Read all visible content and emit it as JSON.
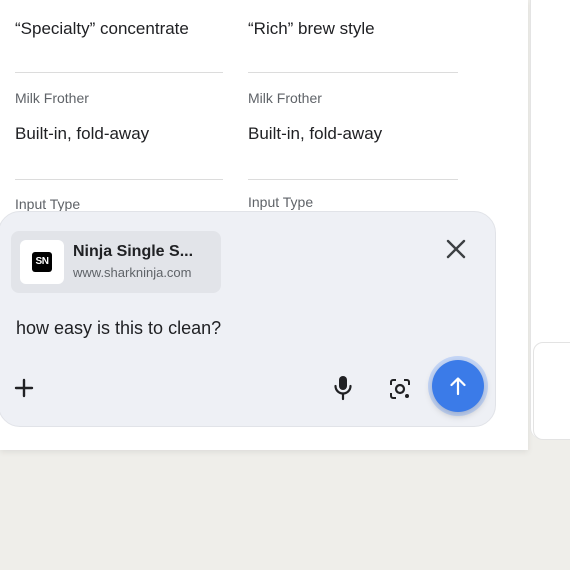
{
  "specs": [
    {
      "label": "",
      "value": "“Specialty” concentrate"
    },
    {
      "label": "",
      "value": "“Rich” brew style"
    },
    {
      "label": "Milk Frother",
      "value": "Built-in, fold-away"
    },
    {
      "label": "Milk Frother",
      "value": "Built-in, fold-away"
    },
    {
      "label": "Input Type",
      "value": ""
    },
    {
      "label": "Input Type",
      "value": ""
    }
  ],
  "chat": {
    "attachment": {
      "logo_text": "SN",
      "title": "Ninja Single S...",
      "url": "www.sharkninja.com"
    },
    "prompt": "how easy is this to clean?"
  },
  "icons": {
    "close": "close-icon",
    "add": "plus-icon",
    "mic": "microphone-icon",
    "lens": "camera-search-icon",
    "send": "arrow-up-icon"
  },
  "colors": {
    "send_button": "#3b7be8",
    "chat_bg": "#eef0f5",
    "chip_bg": "#e2e4e9"
  }
}
